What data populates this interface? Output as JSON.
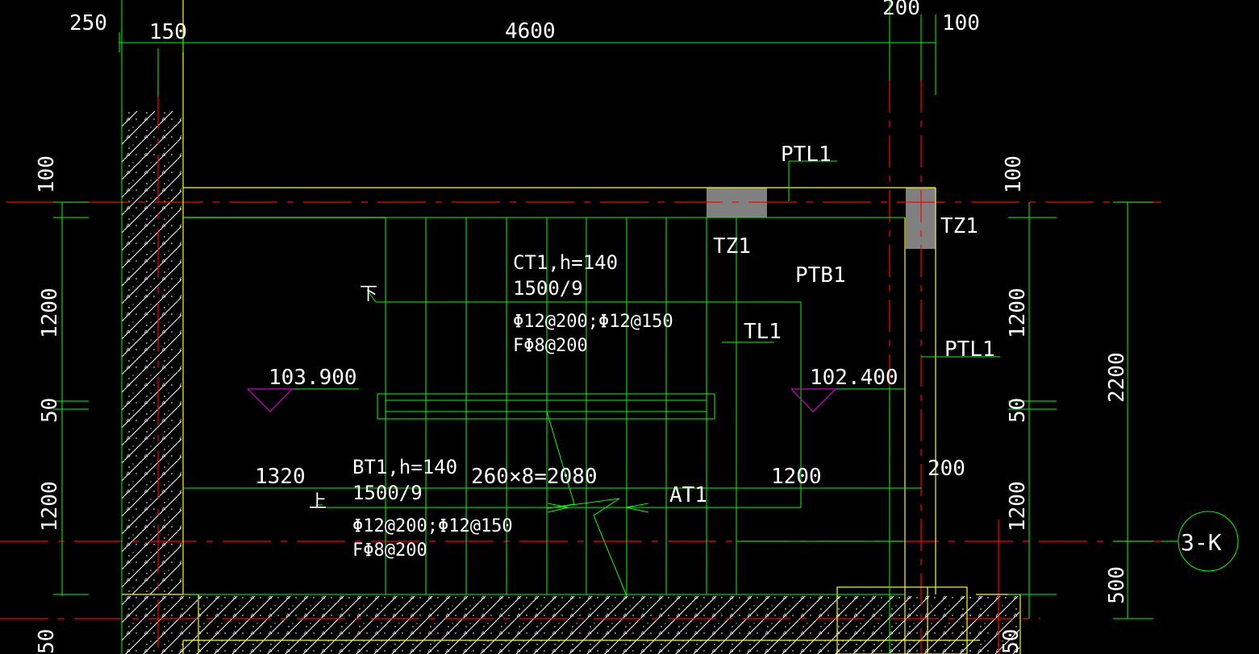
{
  "colors": {
    "background": "#000000",
    "dimension": "#00ff00",
    "axis": "#ff0000",
    "wall_edge": "#ffff00",
    "hatch": "#ffffff",
    "column_fill": "#808080",
    "elevation_marker": "#cc00cc",
    "text": "#ffffff"
  },
  "top_dimensions": {
    "d250": "250",
    "d150": "150",
    "d4600": "4600",
    "d200": "200",
    "d100": "100"
  },
  "left_dimensions": {
    "d100": "100",
    "d1200_upper": "1200",
    "d50": "50",
    "d1200_lower": "1200",
    "d50_bottom": "50"
  },
  "right_dimensions": {
    "d100": "100",
    "d1200_upper": "1200",
    "d50": "50",
    "d1200_lower": "1200",
    "d2200": "2200",
    "d500": "500",
    "d50_bottom": "50"
  },
  "labels": {
    "ptl1_top": "PTL1",
    "tz1_left": "TZ1",
    "tz1_right": "TZ1",
    "ptb1": "PTB1",
    "tl1": "TL1",
    "ptl1_right": "PTL1",
    "at1": "AT1",
    "down_mark": "下",
    "up_mark": "上",
    "grid_axis": "3-K"
  },
  "ct1": {
    "line1": "CT1,h=140",
    "line2": "1500/9",
    "line3": "Φ12@200;Φ12@150",
    "line4": "FΦ8@200"
  },
  "bt1": {
    "line1": "BT1,h=140",
    "line2": "1500/9",
    "line3": "Φ12@200;Φ12@150",
    "line4": "FΦ8@200"
  },
  "elevations": {
    "left": "103.900",
    "right": "102.400"
  },
  "bottom_dimensions": {
    "d1320": "1320",
    "steps": "260×8=2080",
    "d1200": "1200",
    "d200": "200"
  }
}
